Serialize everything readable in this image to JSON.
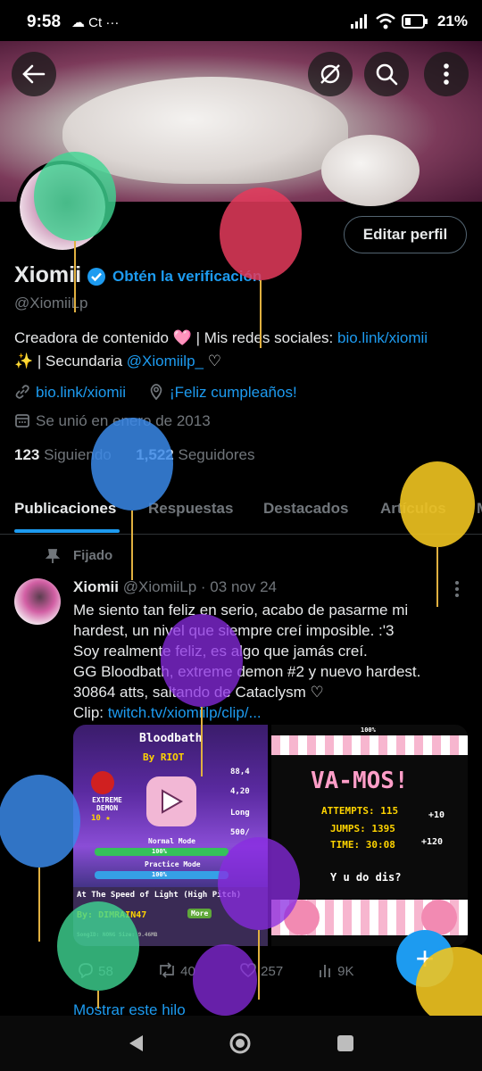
{
  "status_bar": {
    "time": "9:58",
    "left_icons": "☁ Ct ···",
    "battery": "21%"
  },
  "profile": {
    "display_name": "Xiomii",
    "get_verified": "Obtén la verificación",
    "handle": "@XiomiiLp",
    "edit_button": "Editar perfil",
    "bio_line1_text": "Creadora de contenido 🩷 | Mis redes sociales: ",
    "bio_line1_link": "bio.link/xiomii",
    "bio_line2_prefix": "✨ | Secundaria ",
    "bio_line2_link": "@Xiomiilp_",
    "bio_line2_suffix": " ♡",
    "website": "bio.link/xiomii",
    "birthday": "¡Feliz cumpleaños!",
    "joined": "Se unió en enero de 2013",
    "following_count": "123",
    "following_label": "Siguiendo",
    "followers_count": "1,522",
    "followers_label": "Seguidores"
  },
  "tabs": [
    {
      "label": "Publicaciones",
      "active": true
    },
    {
      "label": "Respuestas"
    },
    {
      "label": "Destacados"
    },
    {
      "label": "Artículos"
    },
    {
      "label": "M"
    }
  ],
  "post": {
    "pinned_label": "Fijado",
    "author": "Xiomii",
    "handle_date": "@XiomiiLp · 03 nov 24",
    "lines": [
      "Me siento tan feliz en serio, acabo de pasarme mi",
      "hardest, un nivel que siempre creí imposible. :'3",
      "Soy realmente feliz, es algo que jamás creí.",
      "GG Bloodbath, extreme demon #2 y nuevo hardest.",
      "30864 atts, saltando de Cataclysm ♡"
    ],
    "clip_label": "Clip: ",
    "clip_link": "twitch.tv/xiomiilp/clip/...",
    "media1": {
      "level": "Bloodbath",
      "creator": "By RIOT",
      "difficulty": "EXTREME DEMON",
      "stars": "10 ★",
      "normal_mode": "Normal Mode",
      "practice_mode": "Practice Mode",
      "pct1": "100%",
      "pct2": "100%",
      "song": "At The Speed of Light (High Pitch)",
      "song_by": "By: DIMRAIN47",
      "more": "More",
      "song_meta": "SongID: NONG  Size: 9.46MB",
      "stat1": "88,4",
      "stat2": "4,20",
      "stat3": "Long",
      "stat4": "500/"
    },
    "media2": {
      "percent": "100%",
      "title": "VA-MOS!",
      "attempts": "ATTEMPTS: 115",
      "jumps": "JUMPS: 1395",
      "time": "TIME: 30:08",
      "bonus1": "+10",
      "bonus2": "+120",
      "tagline": "Y u do dis?"
    },
    "replies": "58",
    "reposts": "40",
    "likes": "257",
    "views": "9K",
    "show_thread": "Mostrar este hilo"
  },
  "icons": {
    "back": "back-arrow-icon",
    "search": "search-icon",
    "more": "more-vert-icon"
  }
}
